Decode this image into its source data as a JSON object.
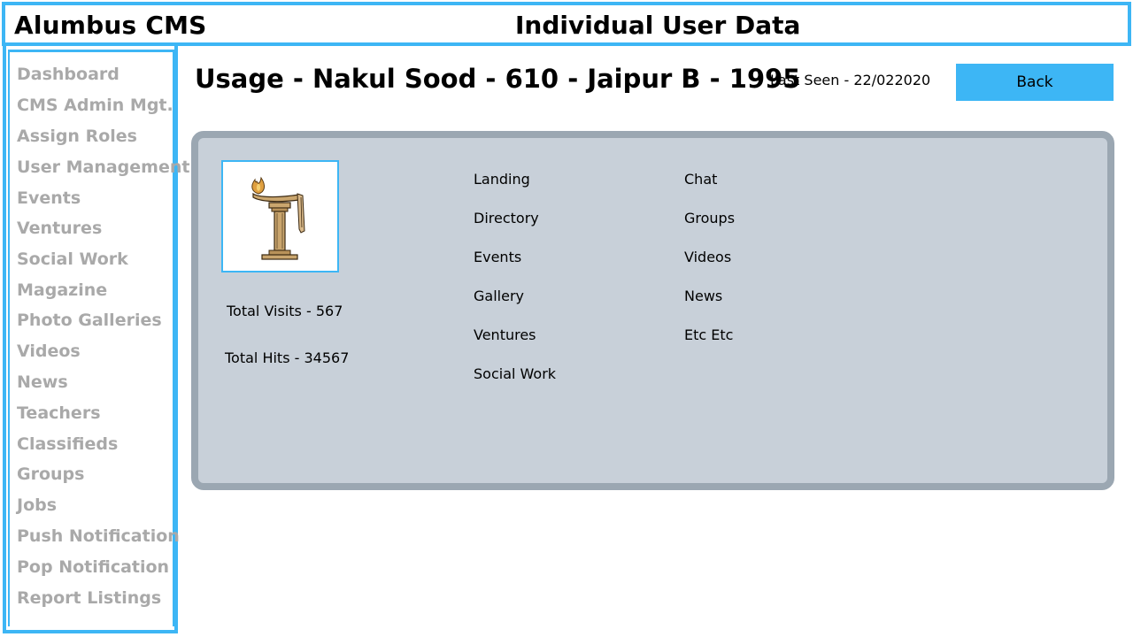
{
  "header": {
    "app_title": "Alumbus CMS",
    "page_heading": "Individual User Data"
  },
  "sidebar": {
    "items": [
      {
        "label": "Dashboard"
      },
      {
        "label": "CMS Admin Mgt."
      },
      {
        "label": "Assign Roles"
      },
      {
        "label": "User Management"
      },
      {
        "label": "Events"
      },
      {
        "label": "Ventures"
      },
      {
        "label": "Social Work"
      },
      {
        "label": "Magazine"
      },
      {
        "label": "Photo Galleries"
      },
      {
        "label": "Videos"
      },
      {
        "label": "News"
      },
      {
        "label": "Teachers"
      },
      {
        "label": "Classifieds"
      },
      {
        "label": "Groups"
      },
      {
        "label": "Jobs"
      },
      {
        "label": "Push Notification"
      },
      {
        "label": "Pop Notification"
      },
      {
        "label": "Report Listings"
      }
    ]
  },
  "main": {
    "usage_title": "Usage - Nakul Sood - 610 - Jaipur B - 1995",
    "last_seen": "Last Seen - 22/022020",
    "back_label": "Back",
    "stats": {
      "total_visits": "Total Visits - 567",
      "total_hits": "Total Hits - 34567"
    },
    "features_col1": [
      "Landing",
      "Directory",
      "Events",
      "Gallery",
      "Ventures",
      "Social Work"
    ],
    "features_col2": [
      "Chat",
      "Groups",
      "Videos",
      "News",
      "Etc Etc"
    ]
  },
  "colors": {
    "accent": "#3db6f5",
    "panel_bg": "#c8d0d9",
    "panel_border": "#9ba7b2",
    "nav_text": "#a9a9a9"
  },
  "icons": {
    "logo": "lamp-logo-icon"
  }
}
